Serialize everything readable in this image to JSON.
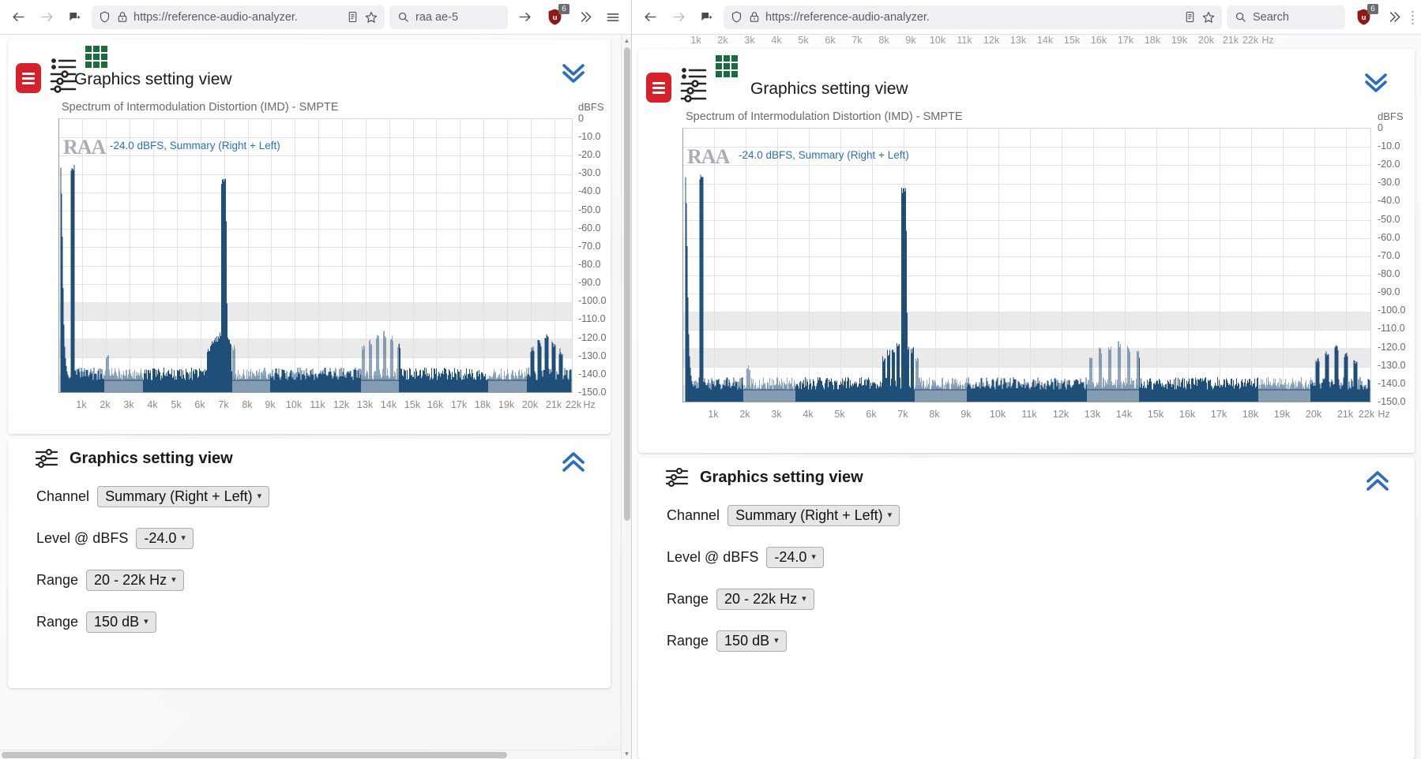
{
  "browser_left": {
    "nav": {
      "back_icon": "back-arrow-icon",
      "forward_icon": "forward-arrow-icon",
      "container_icon": "container-tab-icon"
    },
    "url": "https://reference-audio-analyzer.",
    "shield_icon": "shield-icon",
    "lock_icon": "lock-warning-icon",
    "reader_icon": "reader-view-icon",
    "bookmark_icon": "bookmark-star-icon",
    "search": {
      "value": "raa ae-5",
      "go_icon": "go-arrow-icon",
      "search_icon": "search-icon"
    },
    "extension": {
      "name": "ublock-origin-icon",
      "badge": "6"
    },
    "overflow_icon": "chevron-double-right-icon",
    "menu_icon": "hamburger-menu-icon"
  },
  "browser_right": {
    "url": "https://reference-audio-analyzer.",
    "search": {
      "placeholder": "Search",
      "search_icon": "search-icon"
    },
    "extension": {
      "name": "ublock-origin-icon",
      "badge": "6"
    },
    "overflow_icon": "chevron-double-right-icon"
  },
  "page": {
    "header": {
      "menu_button_icon": "hamburger-red-icon",
      "sliders_icon": "sliders-settings-icon",
      "grid_icon": "green-grid-icon",
      "title": "Graphics setting view",
      "collapse_icon": "chevron-double-down-icon"
    },
    "chart_data": {
      "type": "line",
      "title": "Spectrum of Intermodulation Distortion (IMD) - SMPTE",
      "annotation": "-24.0 dBFS, Summary (Right + Left)",
      "watermark": "RAA",
      "xlabel": "Hz",
      "ylabel": "dBFS",
      "ylim": [
        -150,
        0
      ],
      "xlim": [
        500,
        22000
      ],
      "grid": true,
      "legend_position": "top-left",
      "yticks": [
        "0",
        "-10.0",
        "-20.0",
        "-30.0",
        "-40.0",
        "-50.0",
        "-60.0",
        "-70.0",
        "-80.0",
        "-90.0",
        "-100.0",
        "-110.0",
        "-120.0",
        "-130.0",
        "-140.0",
        "-150.0"
      ],
      "xticks": [
        "1k",
        "2k",
        "3k",
        "4k",
        "5k",
        "6k",
        "7k",
        "8k",
        "9k",
        "10k",
        "11k",
        "12k",
        "13k",
        "14k",
        "15k",
        "16k",
        "17k",
        "18k",
        "19k",
        "20k",
        "21k",
        "22k"
      ],
      "xunit": "Hz",
      "series": [
        {
          "name": "Summary (Right + Left)",
          "color": "#1f4e79",
          "peaks": [
            {
              "freq_hz": 600,
              "level_db": -27
            },
            {
              "freq_hz": 7000,
              "level_db": -34
            },
            {
              "freq_hz": 2100,
              "level_db": -131
            },
            {
              "freq_hz": 6400,
              "level_db": -126
            },
            {
              "freq_hz": 6550,
              "level_db": -123
            },
            {
              "freq_hz": 6700,
              "level_db": -121
            },
            {
              "freq_hz": 6850,
              "level_db": -119
            },
            {
              "freq_hz": 7150,
              "level_db": -120
            },
            {
              "freq_hz": 7300,
              "level_db": -122
            },
            {
              "freq_hz": 7450,
              "level_db": -126
            },
            {
              "freq_hz": 13000,
              "level_db": -126
            },
            {
              "freq_hz": 13300,
              "level_db": -122
            },
            {
              "freq_hz": 13600,
              "level_db": -120
            },
            {
              "freq_hz": 13900,
              "level_db": -118
            },
            {
              "freq_hz": 14200,
              "level_db": -121
            },
            {
              "freq_hz": 14500,
              "level_db": -124
            },
            {
              "freq_hz": 20200,
              "level_db": -127
            },
            {
              "freq_hz": 20500,
              "level_db": -123
            },
            {
              "freq_hz": 20800,
              "level_db": -120
            },
            {
              "freq_hz": 21100,
              "level_db": -124
            },
            {
              "freq_hz": 21400,
              "level_db": -128
            }
          ],
          "noise_floor_db": -142
        }
      ]
    },
    "settings": {
      "icon": "sliders-settings-icon",
      "title": "Graphics setting view",
      "collapse_icon": "chevron-double-up-icon",
      "fields": [
        {
          "label": "Channel",
          "value": "Summary (Right + Left)",
          "name": "channel-select"
        },
        {
          "label": "Level @ dBFS",
          "value": "-24.0",
          "name": "level-select"
        },
        {
          "label": "Range",
          "value": "20 - 22k Hz",
          "name": "frequency-range-select"
        },
        {
          "label": "Range",
          "value": "150 dB",
          "name": "db-range-select"
        }
      ]
    },
    "top_ruler": [
      "1k",
      "2k",
      "3k",
      "4k",
      "5k",
      "6k",
      "7k",
      "8k",
      "9k",
      "10k",
      "11k",
      "12k",
      "13k",
      "14k",
      "15k",
      "16k",
      "17k",
      "18k",
      "19k",
      "20k",
      "21k",
      "22k"
    ],
    "top_ruler_unit": "Hz"
  },
  "colors": {
    "accent_blue": "#2a6ebb",
    "trace_blue": "#1f4e79",
    "menu_red": "#d4212b",
    "grid_green": "#1c6b3c"
  }
}
